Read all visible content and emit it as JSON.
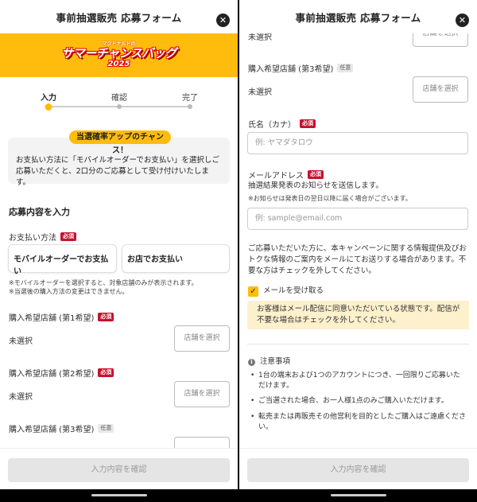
{
  "header": {
    "title": "事前抽選販売 応募フォーム",
    "close_glyph": "✕"
  },
  "banner": {
    "logo_small": "マクドナルドの",
    "logo_main": "サマーチャンスバッグ",
    "logo_year": "2025",
    "bg_color": "#ffbc0d"
  },
  "steps": [
    {
      "label": "入力",
      "active": true
    },
    {
      "label": "確認",
      "active": false
    },
    {
      "label": "完了",
      "active": false
    }
  ],
  "chance": {
    "badge": "当選確率アップのチャンス！",
    "text": "お支払い方法に「モバイルオーダーでお支払い」を選択しご応募いただくと、2口分のご応募として受け付けいたします。"
  },
  "section_title": "応募内容を入力",
  "payment": {
    "label": "お支払い方法",
    "required": "必須",
    "options": [
      "モバイルオーダーでお支払い",
      "お店でお支払い"
    ],
    "note": "※モバイルオーダーを選択すると、対象店舗のみが表示されます。\n※当選後の購入方法の変更はできません。"
  },
  "stores": [
    {
      "label": "購入希望店舗 (第1希望)",
      "tag": "必須",
      "value": "未選択",
      "button": "店舗を選択"
    },
    {
      "label": "購入希望店舗 (第2希望)",
      "tag": "必須",
      "value": "未選択",
      "button": "店舗を選択"
    },
    {
      "label": "購入希望店舗 (第3希望)",
      "tag": "任意",
      "value": "未選択",
      "button": "店舗を選択"
    }
  ],
  "right_top": {
    "prev_value": "未選択",
    "prev_button": "店舗を選択"
  },
  "name": {
    "label": "氏名（カナ）",
    "required": "必須",
    "placeholder": "例: ヤマダタロウ"
  },
  "email": {
    "label": "メールアドレス",
    "required": "必須",
    "desc": "抽選結果発表のお知らせを送信します。",
    "note": "※お知らせは発表日の翌日以降に届く場合がございます。",
    "placeholder": "例: sample@email.com"
  },
  "newsletter": {
    "text": "ご応募いただいた方に、本キャンペーンに関する情報提供及びおトクな情報のご案内をメールにてお送りする場合があります。不要な方はチェックを外してください。",
    "checkbox_label": "メールを受け取る",
    "checked": true,
    "warning": "お客様はメール配信に同意いただいている状態です。配信が不要な場合はチェックを外してください。"
  },
  "notes": {
    "title": "注意事項",
    "items": [
      "1台の端末および1つのアカウントにつき、一回限りご応募いただけます。",
      "ご当選された場合、お一人様1点のみご購入いただけます。",
      "転売または再販売その他営利を目的としたご購入はご遠慮ください。"
    ]
  },
  "footer": {
    "confirm": "入力内容を確認"
  }
}
